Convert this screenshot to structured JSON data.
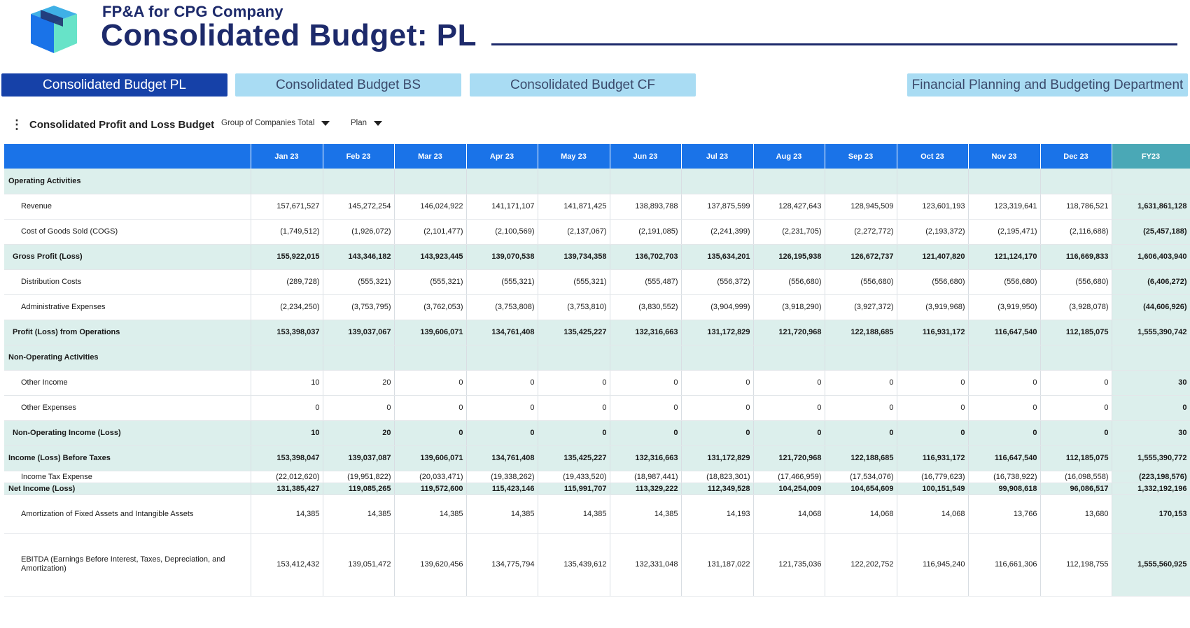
{
  "header": {
    "subtitle": "FP&A for CPG Company",
    "title": "Consolidated Budget: PL",
    "logo": "box-logo-icon"
  },
  "tabs": [
    {
      "label": "Consolidated Budget PL",
      "active": true
    },
    {
      "label": "Consolidated Budget BS",
      "active": false
    },
    {
      "label": "Consolidated Budget CF",
      "active": false
    },
    {
      "label": "Financial Planning and Budgeting Department",
      "active": false
    }
  ],
  "toolbar": {
    "menu_icon": "kebab-menu-icon",
    "title": "Consolidated Profit and Loss Budget",
    "company_filter": "Group of Companies Total",
    "scenario_filter": "Plan"
  },
  "table": {
    "columns": [
      "",
      "Jan 23",
      "Feb 23",
      "Mar 23",
      "Apr 23",
      "May 23",
      "Jun 23",
      "Jul 23",
      "Aug 23",
      "Sep 23",
      "Oct 23",
      "Nov 23",
      "Dec 23",
      "FY23"
    ],
    "rows": [
      {
        "label": "Operating Activities",
        "type": "section",
        "values": [
          "",
          "",
          "",
          "",
          "",
          "",
          "",
          "",
          "",
          "",
          "",
          "",
          ""
        ]
      },
      {
        "label": "Revenue",
        "type": "sub",
        "values": [
          "157,671,527",
          "145,272,254",
          "146,024,922",
          "141,171,107",
          "141,871,425",
          "138,893,788",
          "137,875,599",
          "128,427,643",
          "128,945,509",
          "123,601,193",
          "123,319,641",
          "118,786,521",
          "1,631,861,128"
        ]
      },
      {
        "label": "Cost of Goods Sold (COGS)",
        "type": "sub",
        "values": [
          "(1,749,512)",
          "(1,926,072)",
          "(2,101,477)",
          "(2,100,569)",
          "(2,137,067)",
          "(2,191,085)",
          "(2,241,399)",
          "(2,231,705)",
          "(2,272,772)",
          "(2,193,372)",
          "(2,195,471)",
          "(2,116,688)",
          "(25,457,188)"
        ]
      },
      {
        "label": "Gross Profit (Loss)",
        "type": "subtotal",
        "values": [
          "155,922,015",
          "143,346,182",
          "143,923,445",
          "139,070,538",
          "139,734,358",
          "136,702,703",
          "135,634,201",
          "126,195,938",
          "126,672,737",
          "121,407,820",
          "121,124,170",
          "116,669,833",
          "1,606,403,940"
        ]
      },
      {
        "label": "Distribution Costs",
        "type": "sub",
        "values": [
          "(289,728)",
          "(555,321)",
          "(555,321)",
          "(555,321)",
          "(555,321)",
          "(555,487)",
          "(556,372)",
          "(556,680)",
          "(556,680)",
          "(556,680)",
          "(556,680)",
          "(556,680)",
          "(6,406,272)"
        ]
      },
      {
        "label": "Administrative Expenses",
        "type": "sub",
        "values": [
          "(2,234,250)",
          "(3,753,795)",
          "(3,762,053)",
          "(3,753,808)",
          "(3,753,810)",
          "(3,830,552)",
          "(3,904,999)",
          "(3,918,290)",
          "(3,927,372)",
          "(3,919,968)",
          "(3,919,950)",
          "(3,928,078)",
          "(44,606,926)"
        ]
      },
      {
        "label": "Profit (Loss) from Operations",
        "type": "subtotal",
        "values": [
          "153,398,037",
          "139,037,067",
          "139,606,071",
          "134,761,408",
          "135,425,227",
          "132,316,663",
          "131,172,829",
          "121,720,968",
          "122,188,685",
          "116,931,172",
          "116,647,540",
          "112,185,075",
          "1,555,390,742"
        ]
      },
      {
        "label": "Non-Operating Activities",
        "type": "section",
        "values": [
          "",
          "",
          "",
          "",
          "",
          "",
          "",
          "",
          "",
          "",
          "",
          "",
          ""
        ]
      },
      {
        "label": "Other Income",
        "type": "sub",
        "values": [
          "10",
          "20",
          "0",
          "0",
          "0",
          "0",
          "0",
          "0",
          "0",
          "0",
          "0",
          "0",
          "30"
        ]
      },
      {
        "label": "Other Expenses",
        "type": "sub",
        "values": [
          "0",
          "0",
          "0",
          "0",
          "0",
          "0",
          "0",
          "0",
          "0",
          "0",
          "0",
          "0",
          "0"
        ]
      },
      {
        "label": "Non-Operating Income (Loss)",
        "type": "subtotal",
        "values": [
          "10",
          "20",
          "0",
          "0",
          "0",
          "0",
          "0",
          "0",
          "0",
          "0",
          "0",
          "0",
          "30"
        ]
      },
      {
        "label": "Income (Loss) Before Taxes",
        "type": "section",
        "values": [
          "153,398,047",
          "139,037,087",
          "139,606,071",
          "134,761,408",
          "135,425,227",
          "132,316,663",
          "131,172,829",
          "121,720,968",
          "122,188,685",
          "116,931,172",
          "116,647,540",
          "112,185,075",
          "1,555,390,772"
        ]
      },
      {
        "label": "Income Tax Expense",
        "type": "sub",
        "values": [
          "(22,012,620)",
          "(19,951,822)",
          "(20,033,471)",
          "(19,338,262)",
          "(19,433,520)",
          "(18,987,441)",
          "(18,823,301)",
          "(17,466,959)",
          "(17,534,076)",
          "(16,779,623)",
          "(16,738,922)",
          "(16,098,558)",
          "(223,198,576)"
        ]
      },
      {
        "label": "Net Income (Loss)",
        "type": "section",
        "values": [
          "131,385,427",
          "119,085,265",
          "119,572,600",
          "115,423,146",
          "115,991,707",
          "113,329,222",
          "112,349,528",
          "104,254,009",
          "104,654,609",
          "100,151,549",
          "99,908,618",
          "96,086,517",
          "1,332,192,196"
        ]
      },
      {
        "label": "Amortization of Fixed Assets and Intangible Assets",
        "type": "sub",
        "values": [
          "14,385",
          "14,385",
          "14,385",
          "14,385",
          "14,385",
          "14,385",
          "14,193",
          "14,068",
          "14,068",
          "14,068",
          "13,766",
          "13,680",
          "170,153"
        ]
      },
      {
        "label": "EBITDA (Earnings Before Interest, Taxes, Depreciation, and Amortization)",
        "type": "sub",
        "values": [
          "153,412,432",
          "139,051,472",
          "139,620,456",
          "134,775,794",
          "135,439,612",
          "132,331,048",
          "131,187,022",
          "121,735,036",
          "122,202,752",
          "116,945,240",
          "116,661,306",
          "112,198,755",
          "1,555,560,925"
        ]
      }
    ]
  },
  "colors": {
    "brand_navy": "#1d2a6b",
    "tab_active": "#1641a8",
    "tab_inactive": "#a9dcf3",
    "header_blue": "#1a73e8",
    "header_teal": "#4aa8b6",
    "section_bg": "#dcefec"
  }
}
